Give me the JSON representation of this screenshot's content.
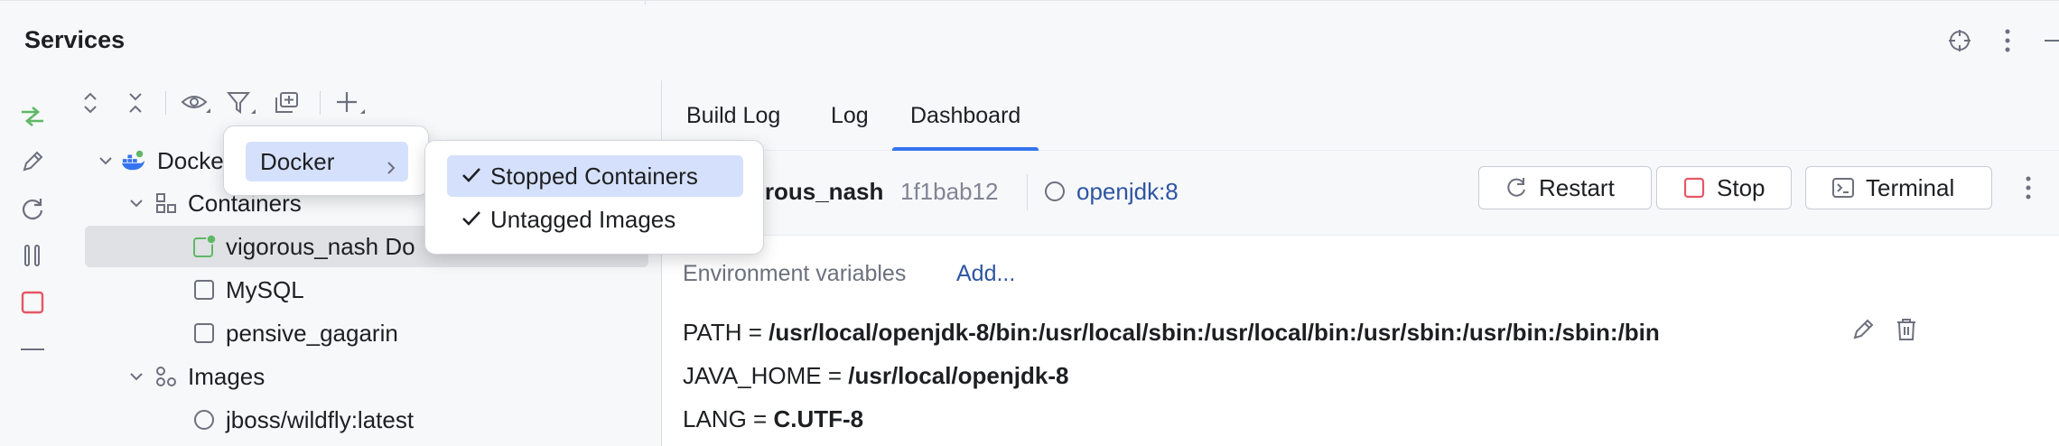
{
  "window": {
    "title": "Services"
  },
  "title_actions": [
    "crosshair-icon",
    "more-vertical-icon",
    "minimize-icon"
  ],
  "left_toolbar": [
    "run-deploy-icon",
    "edit-icon",
    "refresh-icon",
    "pause-icon",
    "stop-icon",
    "collapse-line-icon"
  ],
  "tree_toolbar": [
    "expand-all-icon",
    "collapse-all-icon",
    "view-options-icon",
    "filter-icon",
    "new-group-icon",
    "add-service-icon"
  ],
  "tree": {
    "docker": "Docker",
    "containers": "Containers",
    "items": [
      {
        "label": "vigorous_nash Do",
        "status": "running"
      },
      {
        "label": "MySQL",
        "status": "stopped"
      },
      {
        "label": "pensive_gagarin",
        "status": "stopped"
      }
    ],
    "images": "Images",
    "image_items": [
      {
        "label": "jboss/wildfly:latest"
      }
    ]
  },
  "tabs": [
    {
      "label": "Build Log",
      "active": false
    },
    {
      "label": "Log",
      "active": false
    },
    {
      "label": "Dashboard",
      "active": true
    }
  ],
  "container_header": {
    "name": "orous_nash",
    "id": "1f1bab12",
    "image": "openjdk:8",
    "buttons": {
      "restart": "Restart",
      "stop": "Stop",
      "terminal": "Terminal"
    }
  },
  "env": {
    "label": "Environment variables",
    "add": "Add...",
    "vars": [
      {
        "key": "PATH = ",
        "value": "/usr/local/openjdk-8/bin:/usr/local/sbin:/usr/local/bin:/usr/sbin:/usr/bin:/sbin:/bin"
      },
      {
        "key": "JAVA_HOME = ",
        "value": "/usr/local/openjdk-8"
      },
      {
        "key": "LANG = ",
        "value": "C.UTF-8"
      }
    ]
  },
  "filter_menu": {
    "item": "Docker",
    "submenu": [
      {
        "label": "Stopped Containers",
        "checked": true,
        "highlighted": true
      },
      {
        "label": "Untagged Images",
        "checked": true,
        "highlighted": false
      }
    ]
  },
  "colors": {
    "accent": "#3574f0",
    "link": "#2e55a3",
    "stop_red": "#e55765",
    "run_green": "#5fb865",
    "menu_highlight": "#d5e1fc"
  }
}
